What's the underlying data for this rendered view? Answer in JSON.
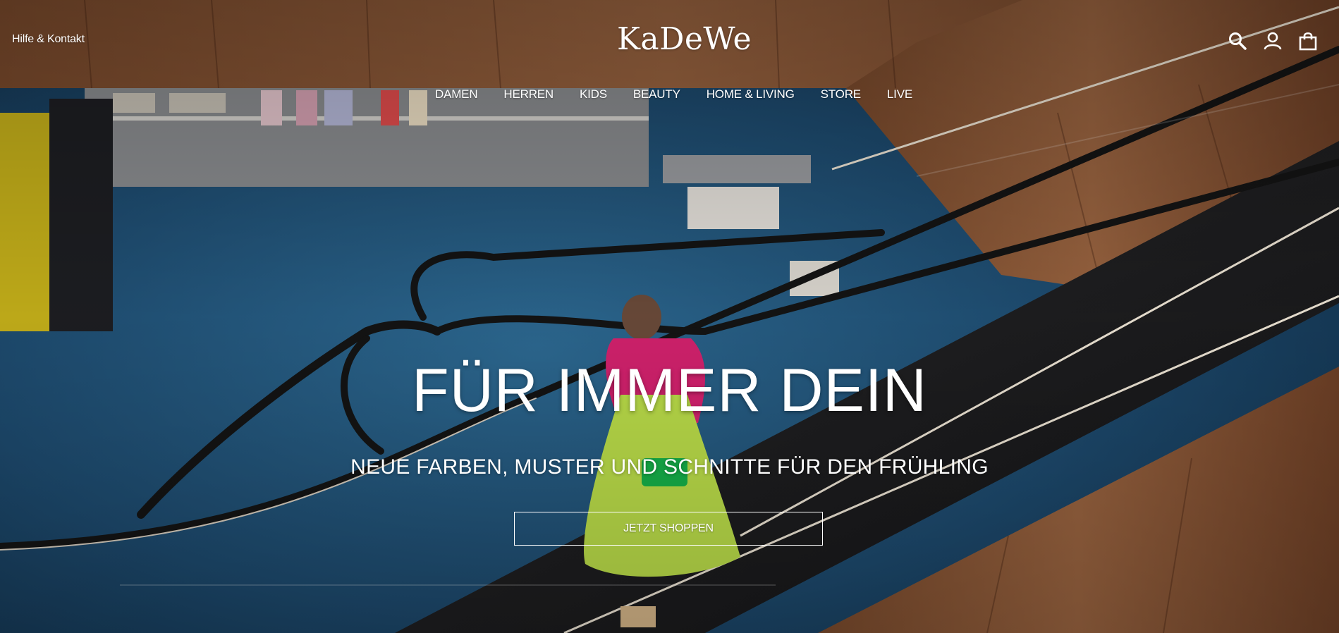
{
  "header": {
    "help_link": "Hilfe & Kontakt",
    "logo_text": "KaDeWe",
    "icons": [
      "search-icon",
      "account-icon",
      "shopping-bag-icon"
    ]
  },
  "nav": {
    "items": [
      {
        "label": "DAMEN"
      },
      {
        "label": "HERREN"
      },
      {
        "label": "KIDS"
      },
      {
        "label": "BEAUTY"
      },
      {
        "label": "HOME & LIVING"
      },
      {
        "label": "STORE"
      },
      {
        "label": "LIVE"
      }
    ]
  },
  "hero": {
    "headline": "FÜR IMMER DEIN",
    "subline": "NEUE FARBEN, MUSTER UND SCHNITTE FÜR DEN FRÜHLING",
    "cta_label": "JETZT SHOPPEN"
  },
  "colors": {
    "text": "#ffffff",
    "wood": "#8a5534",
    "floor": "#1f4f74",
    "dress": "#bde04a",
    "jacket": "#d6226f"
  }
}
